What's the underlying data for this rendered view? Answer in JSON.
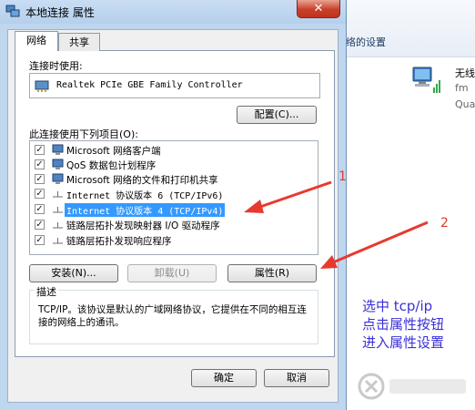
{
  "background_window": {
    "header": "络的设置",
    "network_name": "无线",
    "line2": "fm",
    "line3": "Qua"
  },
  "dialog": {
    "title": "本地连接 属性",
    "close": "✕",
    "tabs": [
      "网络",
      "共享"
    ],
    "connect_using_label": "连接时使用:",
    "adapter": "Realtek PCIe GBE Family Controller",
    "configure_button": "配置(C)...",
    "items_label": "此连接使用下列项目(O):",
    "items": [
      {
        "label": "Microsoft 网络客户端",
        "checked": true,
        "selected": false
      },
      {
        "label": "QoS 数据包计划程序",
        "checked": true,
        "selected": false
      },
      {
        "label": "Microsoft 网络的文件和打印机共享",
        "checked": true,
        "selected": false
      },
      {
        "label": "Internet 协议版本 6 (TCP/IPv6)",
        "checked": true,
        "selected": false
      },
      {
        "label": "Internet 协议版本 4 (TCP/IPv4)",
        "checked": true,
        "selected": true
      },
      {
        "label": "链路层拓扑发现映射器 I/O 驱动程序",
        "checked": true,
        "selected": false
      },
      {
        "label": "链路层拓扑发现响应程序",
        "checked": true,
        "selected": false
      }
    ],
    "install_button": "安装(N)...",
    "uninstall_button": "卸载(U)",
    "properties_button": "属性(R)",
    "description_title": "描述",
    "description_text": "TCP/IP。该协议是默认的广域网络协议，它提供在不同的相互连接的网络上的通讯。",
    "ok_button": "确定",
    "cancel_button": "取消"
  },
  "annotations": {
    "number_1": "1",
    "number_2": "2",
    "instructions": [
      "选中 tcp/ip",
      "点击属性按钮",
      "进入属性设置"
    ]
  },
  "colors": {
    "arrow": "#e8392e",
    "annotation_text": "#3a2fd8",
    "selection": "#3399ff"
  }
}
